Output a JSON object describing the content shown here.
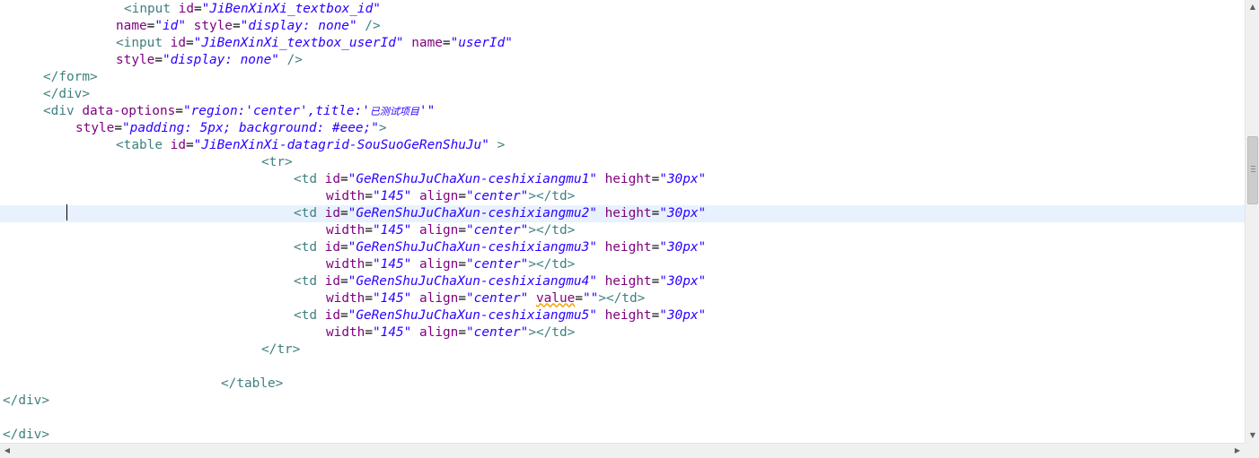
{
  "editor": {
    "current_line_index": 12,
    "lines": [
      {
        "indent": 15,
        "tokens": [
          {
            "c": "tag",
            "t": "<input "
          },
          {
            "c": "attr",
            "t": "id"
          },
          {
            "c": "",
            "t": "="
          },
          {
            "c": "val",
            "t": "\"JiBenXinXi_textbox_id\""
          }
        ]
      },
      {
        "indent": 14,
        "tokens": [
          {
            "c": "attr",
            "t": "name"
          },
          {
            "c": "",
            "t": "="
          },
          {
            "c": "val",
            "t": "\"id\""
          },
          {
            "c": "",
            "t": " "
          },
          {
            "c": "attr",
            "t": "style"
          },
          {
            "c": "",
            "t": "="
          },
          {
            "c": "val",
            "t": "\"display: none\""
          },
          {
            "c": "",
            "t": " "
          },
          {
            "c": "tag",
            "t": "/>"
          }
        ]
      },
      {
        "indent": 14,
        "tokens": [
          {
            "c": "tag",
            "t": "<input "
          },
          {
            "c": "attr",
            "t": "id"
          },
          {
            "c": "",
            "t": "="
          },
          {
            "c": "val",
            "t": "\"JiBenXinXi_textbox_userId\""
          },
          {
            "c": "",
            "t": " "
          },
          {
            "c": "attr",
            "t": "name"
          },
          {
            "c": "",
            "t": "="
          },
          {
            "c": "val",
            "t": "\"userId\""
          }
        ]
      },
      {
        "indent": 14,
        "tokens": [
          {
            "c": "attr",
            "t": "style"
          },
          {
            "c": "",
            "t": "="
          },
          {
            "c": "val",
            "t": "\"display: none\""
          },
          {
            "c": "",
            "t": " "
          },
          {
            "c": "tag",
            "t": "/>"
          }
        ]
      },
      {
        "indent": 5,
        "tokens": [
          {
            "c": "tag",
            "t": "</form>"
          }
        ]
      },
      {
        "indent": 5,
        "tokens": [
          {
            "c": "tag",
            "t": "</div>"
          }
        ]
      },
      {
        "indent": 5,
        "tokens": [
          {
            "c": "tag",
            "t": "<div "
          },
          {
            "c": "attr",
            "t": "data-options"
          },
          {
            "c": "",
            "t": "="
          },
          {
            "c": "val",
            "t": "\"region:'center',title:'"
          },
          {
            "c": "cjk",
            "t": "已测试项目"
          },
          {
            "c": "val",
            "t": "'\""
          }
        ]
      },
      {
        "indent": 9,
        "tokens": [
          {
            "c": "attr",
            "t": "style"
          },
          {
            "c": "",
            "t": "="
          },
          {
            "c": "val",
            "t": "\"padding: 5px; background: #eee;\""
          },
          {
            "c": "tag",
            "t": ">"
          }
        ]
      },
      {
        "indent": 14,
        "tokens": [
          {
            "c": "tag",
            "t": "<table "
          },
          {
            "c": "attr",
            "t": "id"
          },
          {
            "c": "",
            "t": "="
          },
          {
            "c": "val",
            "t": "\"JiBenXinXi-datagrid-SouSuoGeRenShuJu\""
          },
          {
            "c": "",
            "t": " "
          },
          {
            "c": "tag",
            "t": ">"
          }
        ]
      },
      {
        "indent": 32,
        "tokens": [
          {
            "c": "tag",
            "t": "<tr>"
          }
        ]
      },
      {
        "indent": 36,
        "tokens": [
          {
            "c": "tag",
            "t": "<td "
          },
          {
            "c": "attr",
            "t": "id"
          },
          {
            "c": "",
            "t": "="
          },
          {
            "c": "val",
            "t": "\"GeRenShuJuChaXun-ceshixiangmu1\""
          },
          {
            "c": "",
            "t": " "
          },
          {
            "c": "attr",
            "t": "height"
          },
          {
            "c": "",
            "t": "="
          },
          {
            "c": "val",
            "t": "\"30px\""
          }
        ]
      },
      {
        "indent": 40,
        "tokens": [
          {
            "c": "attr",
            "t": "width"
          },
          {
            "c": "",
            "t": "="
          },
          {
            "c": "val",
            "t": "\"145\""
          },
          {
            "c": "",
            "t": " "
          },
          {
            "c": "attr",
            "t": "align"
          },
          {
            "c": "",
            "t": "="
          },
          {
            "c": "val",
            "t": "\"center\""
          },
          {
            "c": "tag",
            "t": "></td>"
          }
        ]
      },
      {
        "indent": 36,
        "tokens": [
          {
            "c": "tag",
            "t": "<td "
          },
          {
            "c": "attr",
            "t": "id"
          },
          {
            "c": "",
            "t": "="
          },
          {
            "c": "val",
            "t": "\"GeRenShuJuChaXun-ceshixiangmu2\""
          },
          {
            "c": "",
            "t": " "
          },
          {
            "c": "attr",
            "t": "height"
          },
          {
            "c": "",
            "t": "="
          },
          {
            "c": "val",
            "t": "\"30px\""
          }
        ]
      },
      {
        "indent": 40,
        "tokens": [
          {
            "c": "attr",
            "t": "width"
          },
          {
            "c": "",
            "t": "="
          },
          {
            "c": "val",
            "t": "\"145\""
          },
          {
            "c": "",
            "t": " "
          },
          {
            "c": "attr",
            "t": "align"
          },
          {
            "c": "",
            "t": "="
          },
          {
            "c": "val",
            "t": "\"center\""
          },
          {
            "c": "tag",
            "t": "></td>"
          }
        ]
      },
      {
        "indent": 36,
        "tokens": [
          {
            "c": "tag",
            "t": "<td "
          },
          {
            "c": "attr",
            "t": "id"
          },
          {
            "c": "",
            "t": "="
          },
          {
            "c": "val",
            "t": "\"GeRenShuJuChaXun-ceshixiangmu3\""
          },
          {
            "c": "",
            "t": " "
          },
          {
            "c": "attr",
            "t": "height"
          },
          {
            "c": "",
            "t": "="
          },
          {
            "c": "val",
            "t": "\"30px\""
          }
        ]
      },
      {
        "indent": 40,
        "tokens": [
          {
            "c": "attr",
            "t": "width"
          },
          {
            "c": "",
            "t": "="
          },
          {
            "c": "val",
            "t": "\"145\""
          },
          {
            "c": "",
            "t": " "
          },
          {
            "c": "attr",
            "t": "align"
          },
          {
            "c": "",
            "t": "="
          },
          {
            "c": "val",
            "t": "\"center\""
          },
          {
            "c": "tag",
            "t": "></td>"
          }
        ]
      },
      {
        "indent": 36,
        "tokens": [
          {
            "c": "tag",
            "t": "<td "
          },
          {
            "c": "attr",
            "t": "id"
          },
          {
            "c": "",
            "t": "="
          },
          {
            "c": "val",
            "t": "\"GeRenShuJuChaXun-ceshixiangmu4\""
          },
          {
            "c": "",
            "t": " "
          },
          {
            "c": "attr",
            "t": "height"
          },
          {
            "c": "",
            "t": "="
          },
          {
            "c": "val",
            "t": "\"30px\""
          }
        ]
      },
      {
        "indent": 40,
        "tokens": [
          {
            "c": "attr",
            "t": "width"
          },
          {
            "c": "",
            "t": "="
          },
          {
            "c": "val",
            "t": "\"145\""
          },
          {
            "c": "",
            "t": " "
          },
          {
            "c": "attr",
            "t": "align"
          },
          {
            "c": "",
            "t": "="
          },
          {
            "c": "val",
            "t": "\"center\""
          },
          {
            "c": "",
            "t": " "
          },
          {
            "c": "attr warn",
            "t": "value"
          },
          {
            "c": "",
            "t": "="
          },
          {
            "c": "val",
            "t": "\"\""
          },
          {
            "c": "tag",
            "t": "></td>"
          }
        ]
      },
      {
        "indent": 36,
        "tokens": [
          {
            "c": "tag",
            "t": "<td "
          },
          {
            "c": "attr",
            "t": "id"
          },
          {
            "c": "",
            "t": "="
          },
          {
            "c": "val",
            "t": "\"GeRenShuJuChaXun-ceshixiangmu5\""
          },
          {
            "c": "",
            "t": " "
          },
          {
            "c": "attr",
            "t": "height"
          },
          {
            "c": "",
            "t": "="
          },
          {
            "c": "val",
            "t": "\"30px\""
          }
        ]
      },
      {
        "indent": 40,
        "tokens": [
          {
            "c": "attr",
            "t": "width"
          },
          {
            "c": "",
            "t": "="
          },
          {
            "c": "val",
            "t": "\"145\""
          },
          {
            "c": "",
            "t": " "
          },
          {
            "c": "attr",
            "t": "align"
          },
          {
            "c": "",
            "t": "="
          },
          {
            "c": "val",
            "t": "\"center\""
          },
          {
            "c": "tag",
            "t": "></td>"
          }
        ]
      },
      {
        "indent": 32,
        "tokens": [
          {
            "c": "tag",
            "t": "</tr>"
          }
        ]
      },
      {
        "indent": 0,
        "tokens": []
      },
      {
        "indent": 27,
        "tokens": [
          {
            "c": "tag",
            "t": "</table>"
          }
        ]
      },
      {
        "indent": 0,
        "tokens": [
          {
            "c": "tag",
            "t": "</div>"
          }
        ]
      },
      {
        "indent": 0,
        "tokens": []
      },
      {
        "indent": 0,
        "tokens": [
          {
            "c": "tag",
            "t": "</div>"
          }
        ]
      }
    ]
  },
  "colors": {
    "tag": "#3f7f7f",
    "attribute": "#7f007f",
    "value": "#2a00ff",
    "current_line": "#e8f2fe",
    "warning_underline": "#f0a000"
  },
  "icons": {
    "scroll_up": "▲",
    "scroll_down": "▼",
    "scroll_left": "◀",
    "scroll_right": "▶"
  }
}
